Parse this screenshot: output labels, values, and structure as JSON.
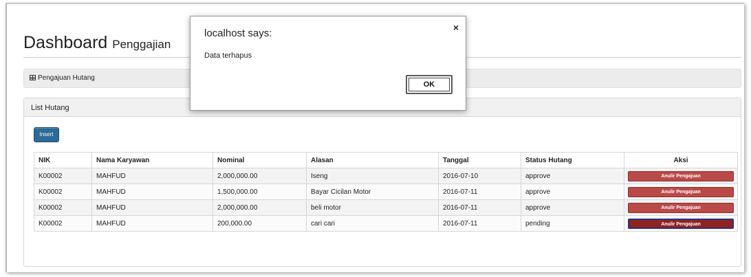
{
  "page": {
    "title": "Dashboard",
    "subtitle": "Penggajian",
    "breadcrumb": "Pengajuan Hutang"
  },
  "panel": {
    "heading": "List Hutang",
    "insert_label": "Insert"
  },
  "table": {
    "headers": [
      "NIK",
      "Nama Karyawan",
      "Nominal",
      "Alasan",
      "Tanggal",
      "Status Hutang",
      "Aksi"
    ],
    "rows": [
      {
        "nik": "K00002",
        "nama": "MAHFUD",
        "nominal": "2,000,000.00",
        "alasan": "Iseng",
        "tanggal": "2016-07-10",
        "status": "approve",
        "aksi": "Anulir Pengajuan"
      },
      {
        "nik": "K00002",
        "nama": "MAHFUD",
        "nominal": "1,500,000.00",
        "alasan": "Bayar Cicilan Motor",
        "tanggal": "2016-07-11",
        "status": "approve",
        "aksi": "Anulir Pengajuan"
      },
      {
        "nik": "K00002",
        "nama": "MAHFUD",
        "nominal": "2,000,000.00",
        "alasan": "beli motor",
        "tanggal": "2016-07-11",
        "status": "approve",
        "aksi": "Anulir Pengajuan"
      },
      {
        "nik": "K00002",
        "nama": "MAHFUD",
        "nominal": "200,000.00",
        "alasan": "cari cari",
        "tanggal": "2016-07-11",
        "status": "pending",
        "aksi": "Anulir Pengajuan"
      }
    ]
  },
  "dialog": {
    "title": "localhost says:",
    "message": "Data terhapus",
    "ok_label": "OK",
    "close_glyph": "×"
  },
  "colors": {
    "insert_button": "#2c6a97",
    "anulir_button": "#b94a48"
  }
}
